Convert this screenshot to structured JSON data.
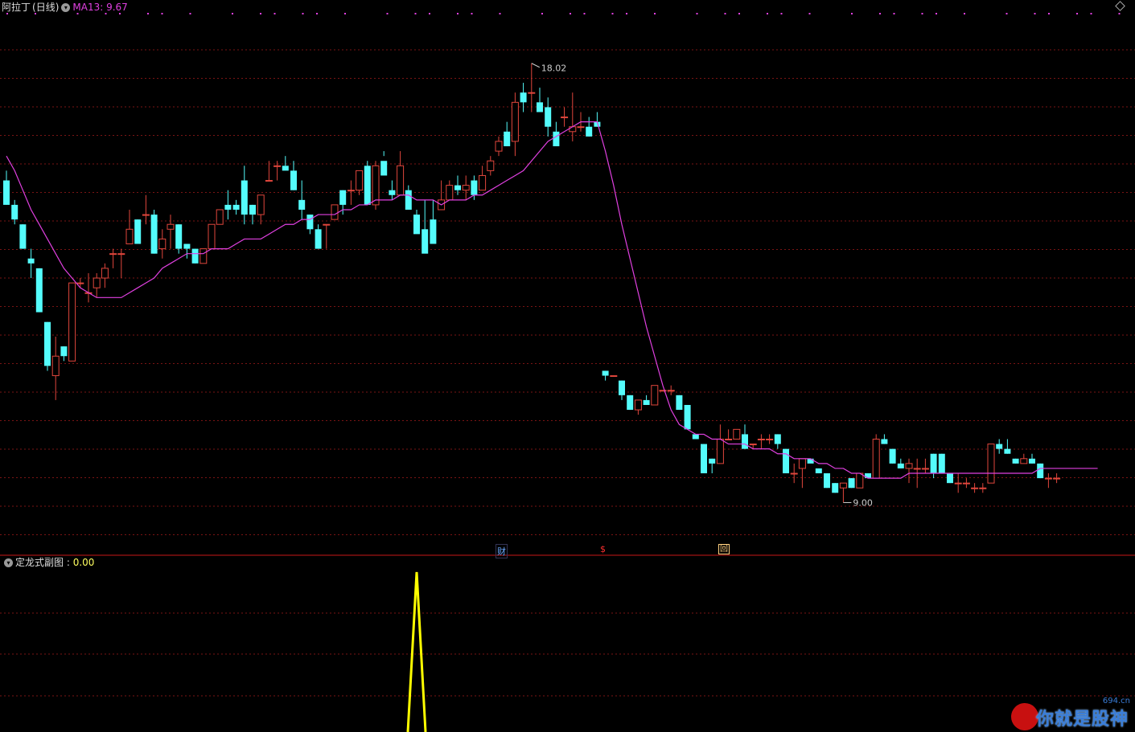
{
  "header": {
    "stock_name": "阿拉丁",
    "period": "(日线)",
    "ma_label": "MA13: 9.67"
  },
  "subchart": {
    "indicator_label": "定龙式副图 : ",
    "indicator_value": "0.00"
  },
  "markers": {
    "cai": "财",
    "dollar": "$",
    "hui": "回"
  },
  "watermark": {
    "site": "694.cn",
    "text": "你就是股神"
  },
  "colors": {
    "up": "#e0463c",
    "down": "#54fcfc",
    "ma": "#e040e0",
    "indicator": "#ffff00",
    "grid": "#7a1414",
    "dots": "#e040e0"
  },
  "chart_data": {
    "type": "candlestick",
    "price_range": [
      8.3,
      19.0
    ],
    "annotations": {
      "high": "18.02",
      "low": "9.00"
    },
    "series": [
      {
        "name": "candles",
        "candles": [
          [
            15.6,
            15.8,
            15.1,
            15.1
          ],
          [
            15.1,
            15.2,
            14.7,
            14.8
          ],
          [
            14.7,
            14.7,
            14.2,
            14.2
          ],
          [
            14.0,
            14.2,
            13.6,
            13.9
          ],
          [
            13.8,
            13.8,
            12.9,
            12.9
          ],
          [
            12.7,
            12.7,
            11.7,
            11.8
          ],
          [
            11.6,
            12.4,
            11.1,
            12.0
          ],
          [
            12.2,
            12.2,
            11.9,
            12.0
          ],
          [
            11.9,
            13.5,
            11.9,
            13.5
          ],
          [
            13.5,
            13.6,
            13.4,
            13.5
          ],
          [
            13.3,
            13.7,
            13.1,
            13.3
          ],
          [
            13.4,
            13.7,
            13.2,
            13.6
          ],
          [
            13.6,
            13.9,
            13.4,
            13.8
          ],
          [
            14.1,
            14.2,
            13.8,
            14.1
          ],
          [
            14.1,
            14.2,
            13.6,
            14.1
          ],
          [
            14.3,
            15.0,
            14.3,
            14.6
          ],
          [
            14.8,
            14.8,
            14.3,
            14.3
          ],
          [
            14.9,
            15.3,
            14.7,
            14.9
          ],
          [
            14.9,
            15.0,
            14.1,
            14.1
          ],
          [
            14.2,
            14.6,
            14.0,
            14.4
          ],
          [
            14.6,
            14.9,
            14.2,
            14.7
          ],
          [
            14.7,
            14.7,
            14.1,
            14.2
          ],
          [
            14.3,
            14.3,
            14.0,
            14.2
          ],
          [
            14.2,
            14.2,
            13.9,
            13.9
          ],
          [
            13.9,
            14.2,
            13.9,
            14.2
          ],
          [
            14.2,
            14.7,
            14.2,
            14.7
          ],
          [
            14.7,
            15.0,
            14.7,
            15.0
          ],
          [
            15.1,
            15.4,
            14.8,
            15.0
          ],
          [
            15.1,
            15.2,
            14.9,
            15.0
          ],
          [
            15.6,
            15.9,
            14.7,
            14.9
          ],
          [
            15.1,
            15.1,
            14.7,
            14.9
          ],
          [
            14.9,
            15.3,
            14.7,
            15.3
          ],
          [
            15.6,
            16.0,
            15.6,
            15.6
          ],
          [
            15.9,
            16.0,
            15.6,
            15.9
          ],
          [
            15.9,
            16.1,
            15.9,
            15.8
          ],
          [
            15.8,
            16.0,
            15.4,
            15.4
          ],
          [
            15.2,
            15.6,
            14.8,
            15.0
          ],
          [
            14.9,
            14.9,
            14.5,
            14.6
          ],
          [
            14.6,
            14.7,
            14.2,
            14.2
          ],
          [
            14.7,
            14.7,
            14.2,
            14.7
          ],
          [
            14.8,
            15.0,
            14.8,
            15.1
          ],
          [
            15.4,
            15.4,
            14.9,
            15.1
          ],
          [
            15.4,
            15.6,
            15.1,
            15.4
          ],
          [
            15.4,
            15.8,
            15.3,
            15.8
          ],
          [
            15.9,
            16.0,
            15.1,
            15.1
          ],
          [
            15.1,
            16.0,
            15.0,
            15.9
          ],
          [
            16.0,
            16.2,
            16.1,
            15.7
          ],
          [
            15.4,
            15.6,
            15.2,
            15.3
          ],
          [
            15.3,
            16.2,
            15.3,
            15.9
          ],
          [
            15.4,
            15.5,
            15.0,
            15.0
          ],
          [
            14.9,
            15.0,
            14.6,
            14.5
          ],
          [
            14.6,
            15.2,
            14.4,
            14.1
          ],
          [
            14.8,
            15.2,
            14.3,
            14.3
          ],
          [
            15.0,
            15.6,
            15.0,
            15.2
          ],
          [
            15.2,
            15.6,
            15.2,
            15.5
          ],
          [
            15.5,
            15.7,
            15.3,
            15.4
          ],
          [
            15.4,
            15.7,
            15.2,
            15.5
          ],
          [
            15.6,
            15.7,
            15.2,
            15.3
          ],
          [
            15.4,
            15.9,
            15.4,
            15.7
          ],
          [
            15.8,
            16.1,
            15.7,
            16.0
          ],
          [
            16.2,
            16.5,
            16.1,
            16.4
          ],
          [
            16.6,
            16.8,
            16.3,
            16.3
          ],
          [
            16.4,
            17.4,
            16.1,
            17.2
          ],
          [
            17.4,
            17.6,
            17.0,
            17.2
          ],
          [
            17.4,
            18.0,
            17.0,
            17.4
          ],
          [
            17.2,
            17.5,
            17.0,
            17.0
          ],
          [
            17.1,
            17.3,
            16.5,
            16.7
          ],
          [
            16.6,
            16.8,
            16.3,
            16.3
          ],
          [
            16.9,
            17.1,
            16.7,
            16.9
          ],
          [
            16.6,
            17.4,
            16.4,
            16.7
          ],
          [
            16.7,
            17.0,
            16.6,
            16.7
          ],
          [
            16.7,
            16.9,
            16.5,
            16.5
          ],
          [
            16.8,
            17.0,
            16.7,
            16.7
          ],
          [
            11.7,
            11.7,
            11.5,
            11.6
          ],
          [
            11.6,
            11.6,
            11.6,
            11.6
          ],
          [
            11.5,
            11.5,
            11.1,
            11.2
          ],
          [
            11.2,
            11.2,
            10.9,
            10.9
          ],
          [
            10.9,
            11.1,
            10.8,
            11.1
          ],
          [
            11.1,
            11.2,
            11.0,
            11.0
          ],
          [
            11.0,
            11.4,
            11.0,
            11.4
          ],
          [
            11.3,
            11.3,
            11.3,
            11.3
          ],
          [
            11.3,
            11.4,
            11.2,
            11.3
          ],
          [
            11.2,
            11.2,
            10.9,
            10.9
          ],
          [
            11.0,
            11.0,
            10.5,
            10.5
          ],
          [
            10.4,
            10.4,
            10.3,
            10.3
          ],
          [
            10.2,
            10.2,
            9.8,
            9.6
          ],
          [
            9.9,
            9.9,
            9.6,
            9.8
          ],
          [
            9.8,
            10.6,
            9.8,
            10.3
          ],
          [
            10.3,
            10.5,
            10.3,
            10.3
          ],
          [
            10.3,
            10.5,
            10.3,
            10.5
          ],
          [
            10.4,
            10.6,
            10.1,
            10.1
          ],
          [
            10.2,
            10.2,
            10.1,
            10.2
          ],
          [
            10.3,
            10.4,
            10.1,
            10.3
          ],
          [
            10.3,
            10.4,
            10.2,
            10.3
          ],
          [
            10.4,
            10.4,
            10.1,
            10.2
          ],
          [
            10.1,
            10.1,
            9.6,
            9.6
          ],
          [
            9.6,
            9.8,
            9.4,
            9.6
          ],
          [
            9.7,
            9.9,
            9.3,
            9.9
          ],
          [
            9.9,
            9.9,
            9.9,
            9.8
          ],
          [
            9.7,
            9.7,
            9.6,
            9.6
          ],
          [
            9.6,
            9.6,
            9.3,
            9.3
          ],
          [
            9.4,
            9.4,
            9.2,
            9.2
          ],
          [
            9.3,
            9.4,
            9.0,
            9.4
          ],
          [
            9.5,
            9.5,
            9.3,
            9.3
          ],
          [
            9.3,
            9.5,
            9.3,
            9.6
          ],
          [
            9.6,
            9.6,
            9.5,
            9.5
          ],
          [
            9.5,
            10.4,
            9.5,
            10.3
          ],
          [
            10.3,
            10.4,
            10.2,
            10.2
          ],
          [
            10.1,
            10.1,
            9.8,
            9.8
          ],
          [
            9.8,
            9.9,
            9.7,
            9.7
          ],
          [
            9.7,
            9.9,
            9.4,
            9.8
          ],
          [
            9.7,
            9.9,
            9.3,
            9.7
          ],
          [
            9.7,
            9.9,
            9.6,
            9.7
          ],
          [
            10.0,
            10.0,
            9.5,
            9.6
          ],
          [
            10.0,
            10.0,
            9.6,
            9.6
          ],
          [
            9.6,
            9.6,
            9.4,
            9.4
          ],
          [
            9.4,
            9.6,
            9.2,
            9.4
          ],
          [
            9.4,
            9.5,
            9.3,
            9.4
          ],
          [
            9.3,
            9.4,
            9.2,
            9.3
          ],
          [
            9.3,
            9.4,
            9.2,
            9.3
          ],
          [
            9.4,
            10.2,
            9.4,
            10.2
          ],
          [
            10.2,
            10.3,
            10.0,
            10.1
          ],
          [
            10.1,
            10.3,
            10.0,
            10.0
          ],
          [
            9.9,
            9.9,
            9.8,
            9.8
          ],
          [
            9.8,
            10.0,
            9.8,
            9.9
          ],
          [
            9.9,
            10.0,
            9.8,
            9.8
          ],
          [
            9.8,
            9.8,
            9.5,
            9.5
          ],
          [
            9.5,
            9.6,
            9.3,
            9.5
          ],
          [
            9.5,
            9.6,
            9.4,
            9.5
          ]
        ]
      },
      {
        "name": "MA13",
        "values": [
          16.1,
          15.8,
          15.4,
          15.0,
          14.7,
          14.4,
          14.1,
          13.8,
          13.6,
          13.4,
          13.3,
          13.2,
          13.2,
          13.2,
          13.2,
          13.3,
          13.4,
          13.5,
          13.6,
          13.8,
          13.9,
          14.0,
          14.1,
          14.1,
          14.1,
          14.2,
          14.2,
          14.2,
          14.3,
          14.4,
          14.4,
          14.4,
          14.5,
          14.6,
          14.7,
          14.7,
          14.8,
          14.8,
          14.9,
          14.9,
          14.9,
          15.0,
          15.0,
          15.1,
          15.1,
          15.2,
          15.2,
          15.2,
          15.3,
          15.3,
          15.2,
          15.2,
          15.2,
          15.1,
          15.2,
          15.2,
          15.2,
          15.3,
          15.3,
          15.4,
          15.5,
          15.6,
          15.7,
          15.8,
          16.0,
          16.2,
          16.4,
          16.5,
          16.6,
          16.7,
          16.8,
          16.8,
          16.8,
          16.2,
          15.5,
          14.7,
          14.0,
          13.3,
          12.6,
          12.0,
          11.4,
          10.9,
          10.6,
          10.5,
          10.4,
          10.4,
          10.3,
          10.3,
          10.2,
          10.2,
          10.2,
          10.1,
          10.1,
          10.1,
          10.0,
          10.0,
          9.9,
          9.9,
          9.9,
          9.8,
          9.8,
          9.7,
          9.7,
          9.6,
          9.6,
          9.5,
          9.5,
          9.5,
          9.5,
          9.5,
          9.6,
          9.6,
          9.6,
          9.6,
          9.6,
          9.6,
          9.6,
          9.6,
          9.6,
          9.6,
          9.6,
          9.6,
          9.6,
          9.6,
          9.6,
          9.6,
          9.7,
          9.7,
          9.7,
          9.7,
          9.7,
          9.7,
          9.7,
          9.7
        ]
      }
    ],
    "indicator": {
      "name": "定龙式副图",
      "spike_index": 50,
      "values_range": [
        0,
        1
      ]
    }
  }
}
